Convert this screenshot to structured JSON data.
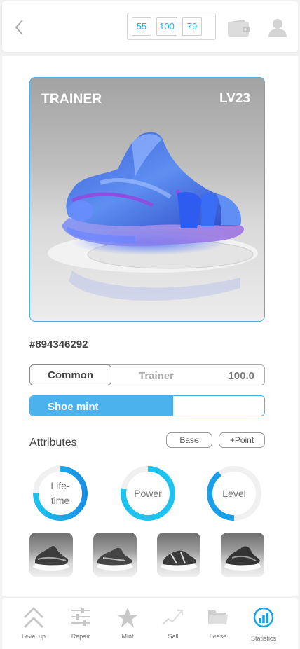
{
  "header": {
    "counters": [
      "55",
      "100",
      "79"
    ]
  },
  "card": {
    "type": "TRAINER",
    "level": "LV23"
  },
  "shoe_id": "#894346292",
  "typebar": {
    "rarity": "Common",
    "type": "Trainer",
    "value": "100.0"
  },
  "mint": {
    "label": "Shoe mint",
    "progress_fraction": 0.61
  },
  "attributes": {
    "title": "Attributes",
    "base_label": "Base",
    "point_label": "+Point",
    "rings": [
      {
        "label_line1": "Life-",
        "label_line2": "time",
        "fraction": 0.75
      },
      {
        "label": "Power",
        "fraction": 0.78
      },
      {
        "label": "Level",
        "fraction": 0.4
      }
    ]
  },
  "tabs": [
    {
      "label": "Level up",
      "icon": "chevrons-up-icon"
    },
    {
      "label": "Repair",
      "icon": "sliders-icon"
    },
    {
      "label": "Mint",
      "icon": "star-icon"
    },
    {
      "label": "Sell",
      "icon": "trend-up-icon"
    },
    {
      "label": "Lease",
      "icon": "folder-icon"
    },
    {
      "label": "Statistics",
      "icon": "stats-circle-icon",
      "active": true
    }
  ],
  "colors": {
    "accent": "#16b4e8",
    "mint_fill": "#4bb2ee",
    "ring_start": "#1ec3f0",
    "ring_end": "#1a8fe6"
  }
}
